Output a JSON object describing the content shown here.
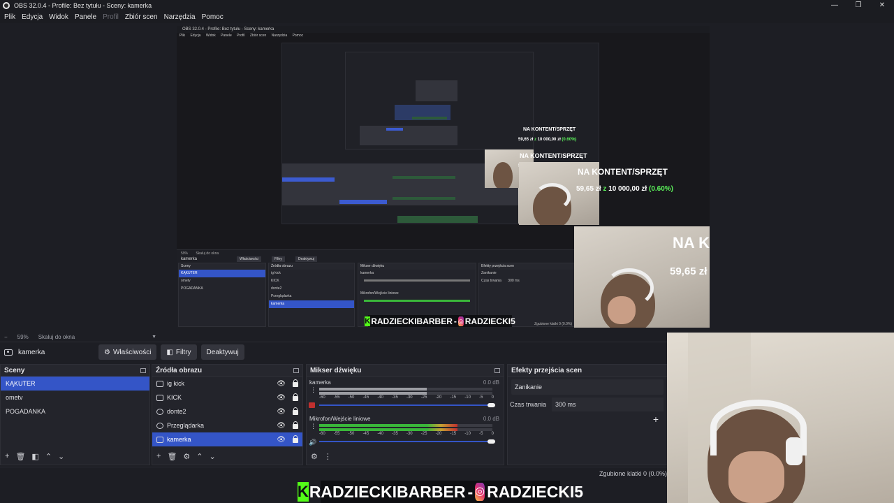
{
  "window": {
    "title": "OBS 32.0.4 - Profile: Bez tytułu - Sceny: kamerka",
    "controls": [
      "—",
      "❐",
      "✕"
    ]
  },
  "menu": [
    "Plik",
    "Edycja",
    "Widok",
    "Panele",
    "Profil",
    "Zbiór scen",
    "Narzędzia",
    "Pomoc"
  ],
  "preview": {
    "nested_title": "OBS 32.0.4 - Profile: Bez tytułu - Sceny: kamerka",
    "nested_menu": [
      "Plik",
      "Edycja",
      "Widok",
      "Panele",
      "Profil",
      "Zbiór scen",
      "Narzędzia",
      "Pomoc"
    ],
    "overlay_heading": "NA KONTENT/SPRZĘT",
    "overlay_amount_a": "59,65 zł",
    "overlay_amount_z": "z",
    "overlay_amount_b": "10 000,00 zł",
    "overlay_percent": "(0.60%)",
    "banner_kick": "RADZIECKIBARBER",
    "banner_sep": "-",
    "banner_ig": "RADZIECKI5",
    "nested_source_name": "kamerka",
    "nested_buttons": [
      "Właściwości",
      "Filtry",
      "Deaktywuj"
    ],
    "nested_zoom": "59%",
    "nested_zoom_mode": "Skaluj do okna",
    "nested_panels": [
      "Sceny",
      "Źródła obrazu",
      "Mikser dźwięku",
      "Efekty przejścia scen"
    ],
    "nested_status": "Zgubione klatki 0 (0.0%)"
  },
  "zoom": {
    "value": "59%",
    "mode": "Skaluj do okna"
  },
  "source_toolbar": {
    "source_name": "kamerka",
    "properties": "Właściwości",
    "filters": "Filtry",
    "deactivate": "Deaktywuj"
  },
  "scenes": {
    "title": "Sceny",
    "items": [
      "KĄKUTER",
      "ometv",
      "POGADANKA"
    ],
    "selected": 0
  },
  "sources": {
    "title": "Źródła obrazu",
    "items": [
      {
        "name": "ig kick",
        "icon": "image-icon"
      },
      {
        "name": "KICK",
        "icon": "image-icon"
      },
      {
        "name": "donte2",
        "icon": "globe-icon"
      },
      {
        "name": "Przeglądarka",
        "icon": "globe-icon"
      },
      {
        "name": "kamerka",
        "icon": "camera-icon"
      }
    ],
    "selected": 4
  },
  "mixer": {
    "title": "Mikser dźwięku",
    "channels": [
      {
        "name": "kamerka",
        "db": "0.0 dB",
        "level": 0.62,
        "muted": true
      },
      {
        "name": "Mikrofon/Wejście liniowe",
        "db": "0.0 dB",
        "level": 0.8,
        "muted": false
      }
    ],
    "scale": [
      "-60",
      "-55",
      "-50",
      "-45",
      "-40",
      "-35",
      "-30",
      "-25",
      "-20",
      "-15",
      "-10",
      "-5",
      "0"
    ]
  },
  "transitions": {
    "title": "Efekty przejścia scen",
    "effect": "Zanikanie",
    "duration_label": "Czas trwania",
    "duration_value": "300 ms"
  },
  "status": {
    "dropped": "Zgubione klatki 0 (0.0%)"
  },
  "colors": {
    "accent": "#3455c7",
    "kick_green": "#53fc18",
    "percent_green": "#5bf15a"
  }
}
